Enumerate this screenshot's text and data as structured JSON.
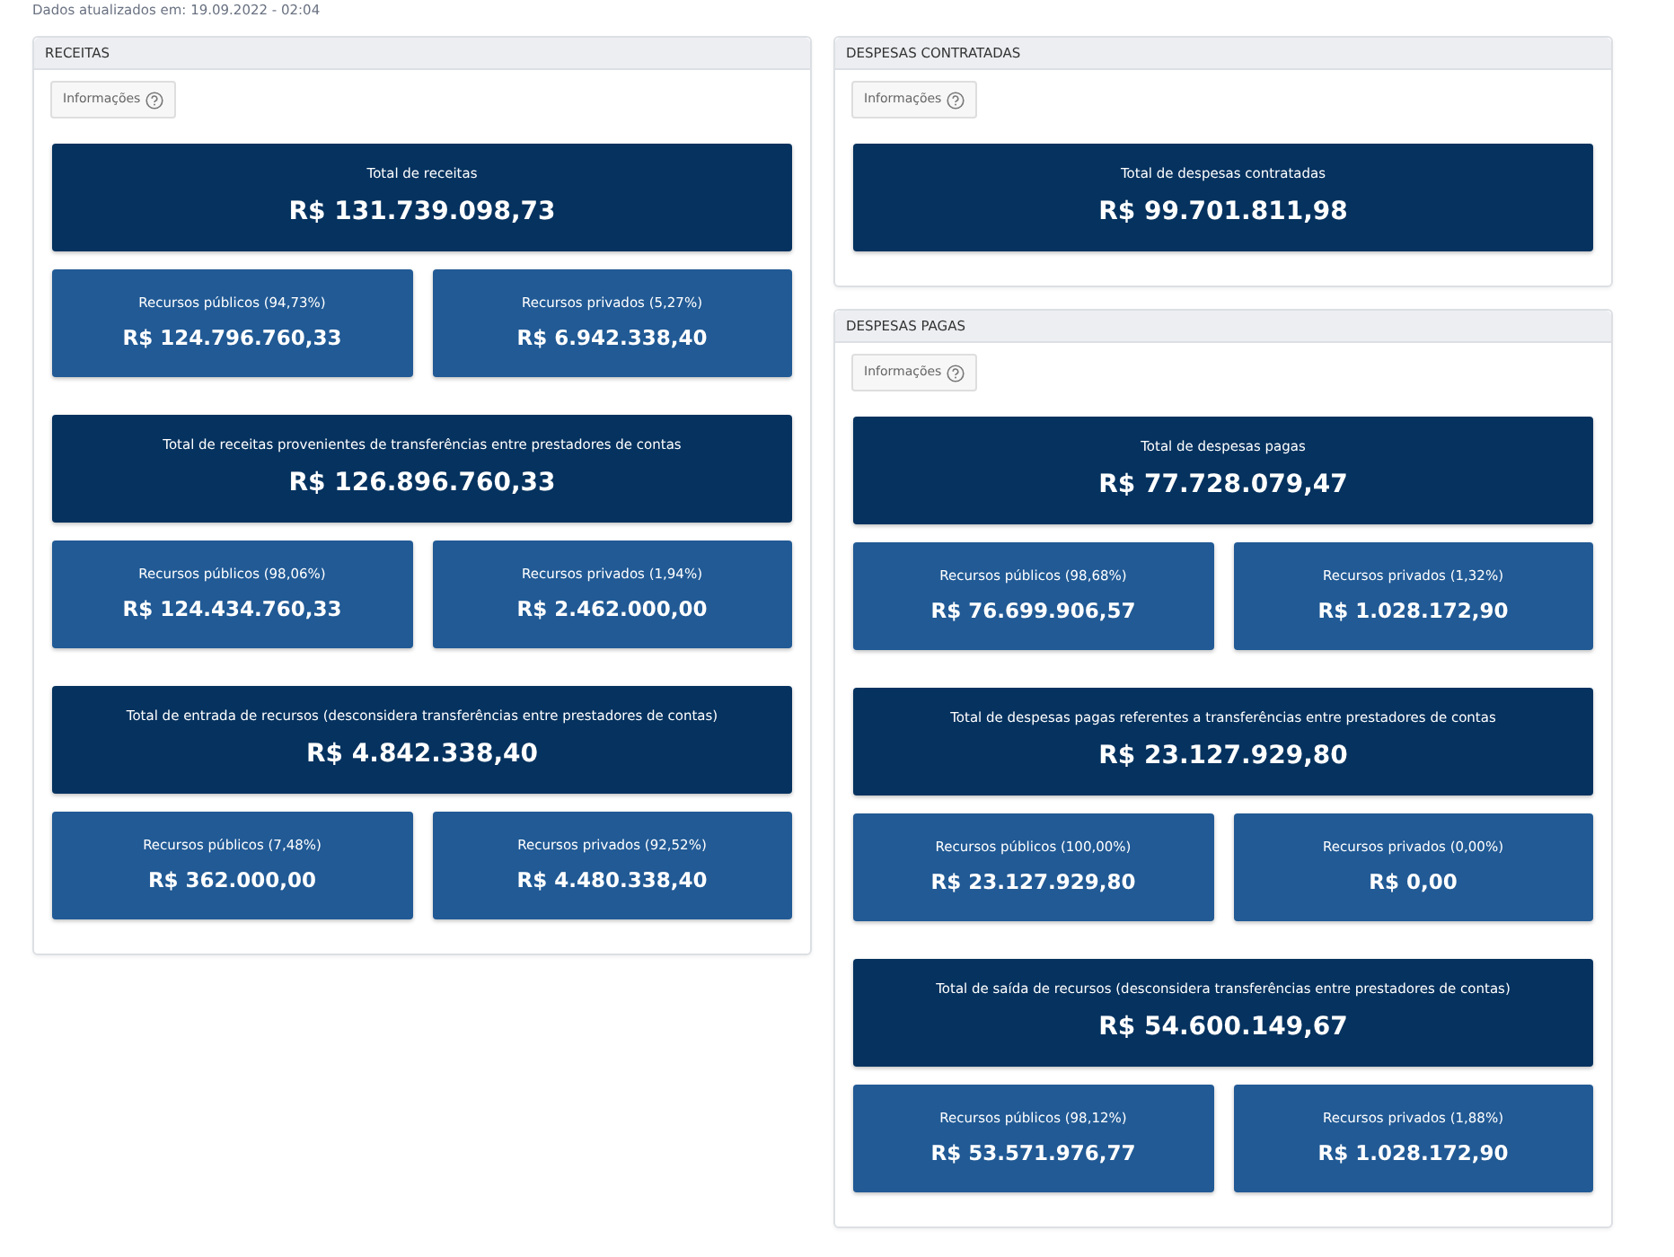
{
  "updated_note": "Dados atualizados em: 19.09.2022 - 02:04",
  "columns": [
    {
      "sections": [
        {
          "title": "RECEITAS",
          "info_button": "Informações",
          "groups": [
            {
              "total": {
                "label": "Total de receitas",
                "value": "R$ 131.739.098,73"
              },
              "parts": [
                {
                  "label": "Recursos públicos (94,73%)",
                  "value": "R$ 124.796.760,33"
                },
                {
                  "label": "Recursos privados (5,27%)",
                  "value": "R$ 6.942.338,40"
                }
              ]
            },
            {
              "total": {
                "label": "Total de receitas provenientes de transferências entre prestadores de contas",
                "value": "R$ 126.896.760,33"
              },
              "parts": [
                {
                  "label": "Recursos públicos (98,06%)",
                  "value": "R$ 124.434.760,33"
                },
                {
                  "label": "Recursos privados (1,94%)",
                  "value": "R$ 2.462.000,00"
                }
              ]
            },
            {
              "total": {
                "label": "Total de entrada de recursos (desconsidera transferências entre prestadores de contas)",
                "value": "R$ 4.842.338,40"
              },
              "parts": [
                {
                  "label": "Recursos públicos (7,48%)",
                  "value": "R$ 362.000,00"
                },
                {
                  "label": "Recursos privados (92,52%)",
                  "value": "R$ 4.480.338,40"
                }
              ]
            }
          ]
        }
      ]
    },
    {
      "sections": [
        {
          "title": "DESPESAS CONTRATADAS",
          "info_button": "Informações",
          "groups": [
            {
              "total": {
                "label": "Total de despesas contratadas",
                "value": "R$ 99.701.811,98"
              }
            }
          ]
        },
        {
          "title": "DESPESAS PAGAS",
          "info_button": "Informações",
          "groups": [
            {
              "total": {
                "label": "Total de despesas pagas",
                "value": "R$ 77.728.079,47"
              },
              "parts": [
                {
                  "label": "Recursos públicos (98,68%)",
                  "value": "R$ 76.699.906,57"
                },
                {
                  "label": "Recursos privados (1,32%)",
                  "value": "R$ 1.028.172,90"
                }
              ]
            },
            {
              "total": {
                "label": "Total de despesas pagas referentes a transferências entre prestadores de contas",
                "value": "R$ 23.127.929,80"
              },
              "parts": [
                {
                  "label": "Recursos públicos (100,00%)",
                  "value": "R$ 23.127.929,80"
                },
                {
                  "label": "Recursos privados (0,00%)",
                  "value": "R$ 0,00"
                }
              ]
            },
            {
              "total": {
                "label": "Total de saída de recursos (desconsidera transferências entre prestadores de contas)",
                "value": "R$ 54.600.149,67"
              },
              "parts": [
                {
                  "label": "Recursos públicos (98,12%)",
                  "value": "R$ 53.571.976,77"
                },
                {
                  "label": "Recursos privados (1,88%)",
                  "value": "R$ 1.028.172,90"
                }
              ]
            }
          ]
        }
      ]
    }
  ]
}
